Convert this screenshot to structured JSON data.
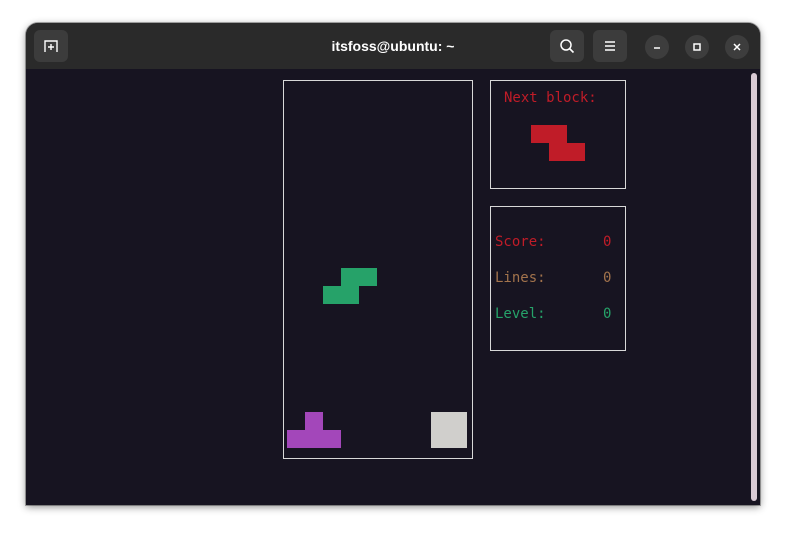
{
  "window": {
    "title": "itsfoss@ubuntu: ~"
  },
  "icons": {
    "new_tab": "new-tab-icon",
    "search": "search-icon",
    "menu": "hamburger-menu-icon",
    "minimize": "minimize-icon",
    "maximize": "maximize-icon",
    "close": "close-icon"
  },
  "colors": {
    "terminal_bg": "#171421",
    "red": "#c01c28",
    "green": "#26a269",
    "purple": "#a347ba",
    "white_block": "#d0cfcc",
    "orange": "#a2734c"
  },
  "game": {
    "next_label": "Next block:",
    "score_label": "Score:",
    "score_value": "0",
    "lines_label": "Lines:",
    "lines_value": "0",
    "level_label": "Level:",
    "level_value": "0"
  }
}
